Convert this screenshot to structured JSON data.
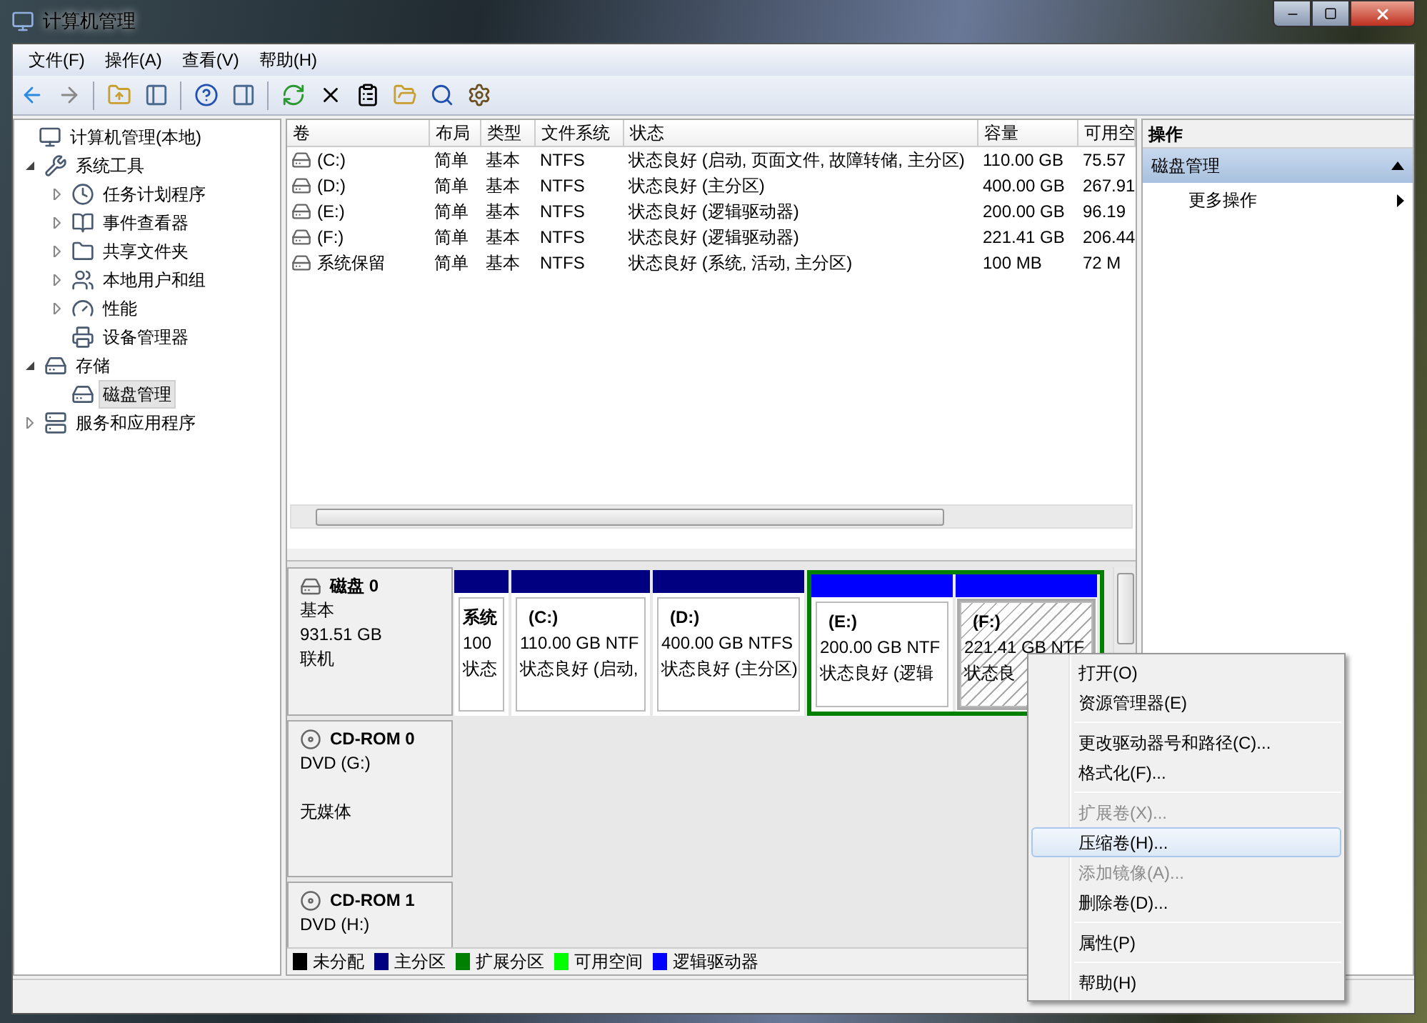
{
  "window": {
    "title": "计算机管理"
  },
  "menu_bar": [
    "文件(F)",
    "操作(A)",
    "查看(V)",
    "帮助(H)"
  ],
  "tree": [
    {
      "label": "计算机管理(本地)",
      "children": [
        {
          "label": "系统工具",
          "expanded": true,
          "children": [
            {
              "label": "任务计划程序",
              "expanded": false
            },
            {
              "label": "事件查看器",
              "expanded": false
            },
            {
              "label": "共享文件夹",
              "expanded": false
            },
            {
              "label": "本地用户和组",
              "expanded": false
            },
            {
              "label": "性能",
              "expanded": false
            },
            {
              "label": "设备管理器"
            }
          ]
        },
        {
          "label": "存储",
          "expanded": true,
          "children": [
            {
              "label": "磁盘管理",
              "selected": true
            }
          ]
        },
        {
          "label": "服务和应用程序",
          "expanded": false
        }
      ]
    }
  ],
  "volume_table": {
    "columns": [
      "卷",
      "布局",
      "类型",
      "文件系统",
      "状态",
      "容量",
      "可用空"
    ],
    "rows": [
      [
        "(C:)",
        "简单",
        "基本",
        "NTFS",
        "状态良好 (启动, 页面文件, 故障转储, 主分区)",
        "110.00 GB",
        "75.57"
      ],
      [
        "(D:)",
        "简单",
        "基本",
        "NTFS",
        "状态良好 (主分区)",
        "400.00 GB",
        "267.91"
      ],
      [
        "(E:)",
        "简单",
        "基本",
        "NTFS",
        "状态良好 (逻辑驱动器)",
        "200.00 GB",
        "96.19"
      ],
      [
        "(F:)",
        "简单",
        "基本",
        "NTFS",
        "状态良好 (逻辑驱动器)",
        "221.41 GB",
        "206.44"
      ],
      [
        "系统保留",
        "简单",
        "基本",
        "NTFS",
        "状态良好 (系统, 活动, 主分区)",
        "100 MB",
        "72 M"
      ]
    ]
  },
  "disks": [
    {
      "kind": "disk",
      "name": "磁盘 0",
      "lines": [
        "基本",
        "931.51 GB",
        "联机"
      ],
      "partitions": [
        {
          "kind": "primary",
          "label": "系统",
          "size": "100",
          "status": "状态",
          "selected": false
        },
        {
          "kind": "primary",
          "label": "(C:)",
          "size": "110.00 GB NTF",
          "status": "状态良好 (启动,",
          "selected": false
        },
        {
          "kind": "primary",
          "label": "(D:)",
          "size": "400.00 GB NTFS",
          "status": "状态良好 (主分区)",
          "selected": false
        },
        {
          "kind": "logical",
          "label": "(E:)",
          "size": "200.00 GB NTF",
          "status": "状态良好 (逻辑",
          "selected": false
        },
        {
          "kind": "logical",
          "label": "(F:)",
          "size": "221.41 GB NTF",
          "status": "状态良",
          "selected": true
        }
      ]
    },
    {
      "kind": "cdrom",
      "name": "CD-ROM 0",
      "lines": [
        "DVD (G:)"
      ],
      "status": "无媒体"
    },
    {
      "kind": "cdrom",
      "name": "CD-ROM 1",
      "lines": [
        "DVD (H:)"
      ]
    }
  ],
  "legend": [
    {
      "label": "未分配",
      "color": "#000000"
    },
    {
      "label": "主分区",
      "color": "#000080"
    },
    {
      "label": "扩展分区",
      "color": "#008000"
    },
    {
      "label": "可用空间",
      "color": "#00ff00"
    },
    {
      "label": "逻辑驱动器",
      "color": "#0000ff"
    }
  ],
  "actions": {
    "title": "操作",
    "section": {
      "label": "磁盘管理",
      "expanded": true
    },
    "items": [
      "更多操作"
    ]
  },
  "context_menu": {
    "groups": [
      [
        {
          "label": "打开(O)",
          "disabled": false,
          "selected": false
        },
        {
          "label": "资源管理器(E)",
          "disabled": false,
          "selected": false
        }
      ],
      [
        {
          "label": "更改驱动器号和路径(C)...",
          "disabled": false,
          "selected": false
        },
        {
          "label": "格式化(F)...",
          "disabled": false,
          "selected": false
        }
      ],
      [
        {
          "label": "扩展卷(X)...",
          "disabled": true,
          "selected": false
        },
        {
          "label": "压缩卷(H)...",
          "disabled": false,
          "selected": true
        },
        {
          "label": "添加镜像(A)...",
          "disabled": true,
          "selected": false
        },
        {
          "label": "删除卷(D)...",
          "disabled": false,
          "selected": false
        }
      ],
      [
        {
          "label": "属性(P)",
          "disabled": false,
          "selected": false
        }
      ],
      [
        {
          "label": "帮助(H)",
          "disabled": false,
          "selected": false
        }
      ]
    ]
  }
}
